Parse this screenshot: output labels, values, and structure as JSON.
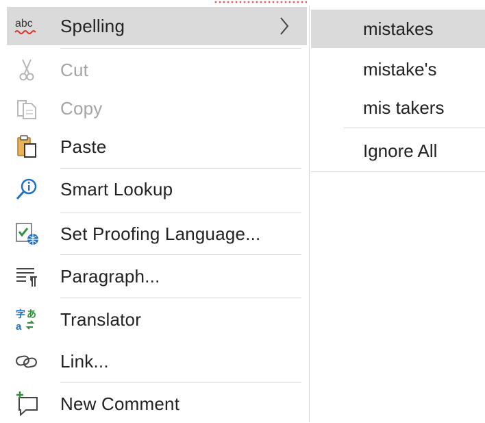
{
  "context_menu": {
    "items": [
      {
        "label": "Spelling",
        "icon": "abc-spelling-icon",
        "enabled": true,
        "submenu": true
      },
      {
        "label": "Cut",
        "icon": "scissors-icon",
        "enabled": false
      },
      {
        "label": "Copy",
        "icon": "copy-icon",
        "enabled": false
      },
      {
        "label": "Paste",
        "icon": "paste-clipboard-icon",
        "enabled": true
      },
      {
        "label": "Smart Lookup",
        "icon": "smart-lookup-icon",
        "enabled": true
      },
      {
        "label": "Set Proofing Language...",
        "icon": "proofing-language-icon",
        "enabled": true
      },
      {
        "label": "Paragraph...",
        "icon": "paragraph-icon",
        "enabled": true
      },
      {
        "label": "Translator",
        "icon": "translator-icon",
        "enabled": true
      },
      {
        "label": "Link...",
        "icon": "link-icon",
        "enabled": true
      },
      {
        "label": "New Comment",
        "icon": "new-comment-icon",
        "enabled": true
      }
    ],
    "spelling_icon_text": "abc"
  },
  "spelling_submenu": {
    "suggestions": [
      "mistakes",
      "mistake's",
      "mis takers"
    ],
    "ignore_all": "Ignore All"
  },
  "colors": {
    "hover": "#dadada",
    "disabled_text": "#a5a5a5",
    "accent_blue": "#1f6fc5",
    "squiggle_red": "#e03131"
  }
}
